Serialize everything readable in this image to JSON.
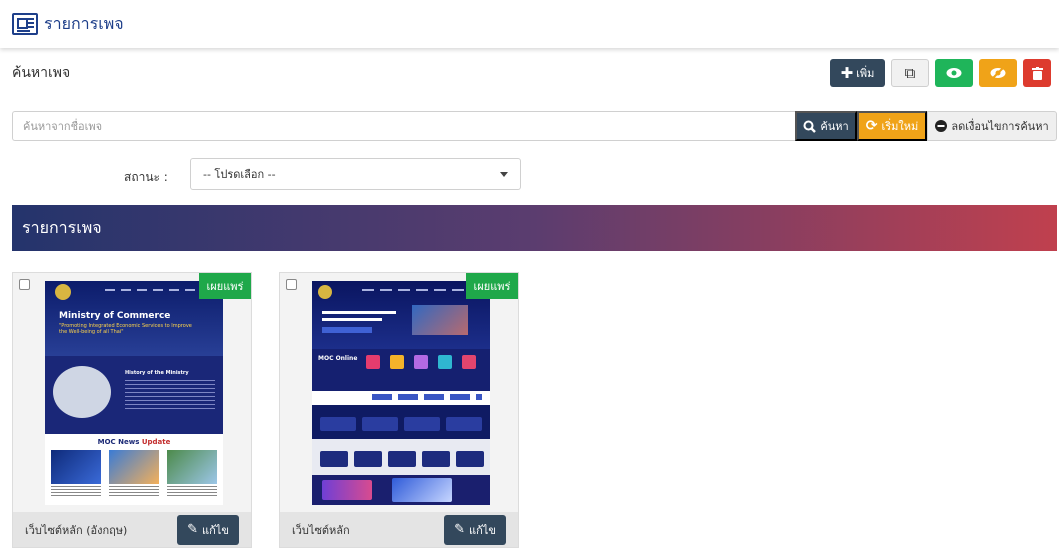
{
  "header": {
    "title": "รายการเพจ",
    "icon": "newspaper-icon"
  },
  "search_section": {
    "label": "ค้นหาเพจ"
  },
  "toolbar": {
    "add_label": "เพิ่ม",
    "colors": {
      "add": "#33485c",
      "show": "#1fb55a",
      "hide": "#f0a318",
      "delete": "#dd3b2e"
    }
  },
  "search": {
    "placeholder": "ค้นหาจากชื่อเพจ",
    "search_label": "ค้นหา",
    "reset_label": "เริ่มใหม่",
    "clear_label": "ลดเงื่อนไขการค้นหา"
  },
  "filter": {
    "status_label": "สถานะ :",
    "status_value": "-- โปรดเลือก --"
  },
  "list": {
    "title": "รายการเพจ",
    "items": [
      {
        "name": "เว็บไซต์หลัก (อังกฤษ)",
        "badge": "เผยแพร่",
        "edit_label": "แก้ไข",
        "thumb": {
          "hero_title": "Ministry of Commerce",
          "hero_sub": "\"Promoting Integrated Economic Services to Improve the Well-being of all Thai\"",
          "history_title": "History of the Ministry",
          "news_title": "MOC News",
          "news_highlight": "Update"
        }
      },
      {
        "name": "เว็บไซต์หลัก",
        "badge": "เผยแพร่",
        "edit_label": "แก้ไข",
        "thumb": {
          "section_title": "MOC Online"
        }
      }
    ]
  }
}
